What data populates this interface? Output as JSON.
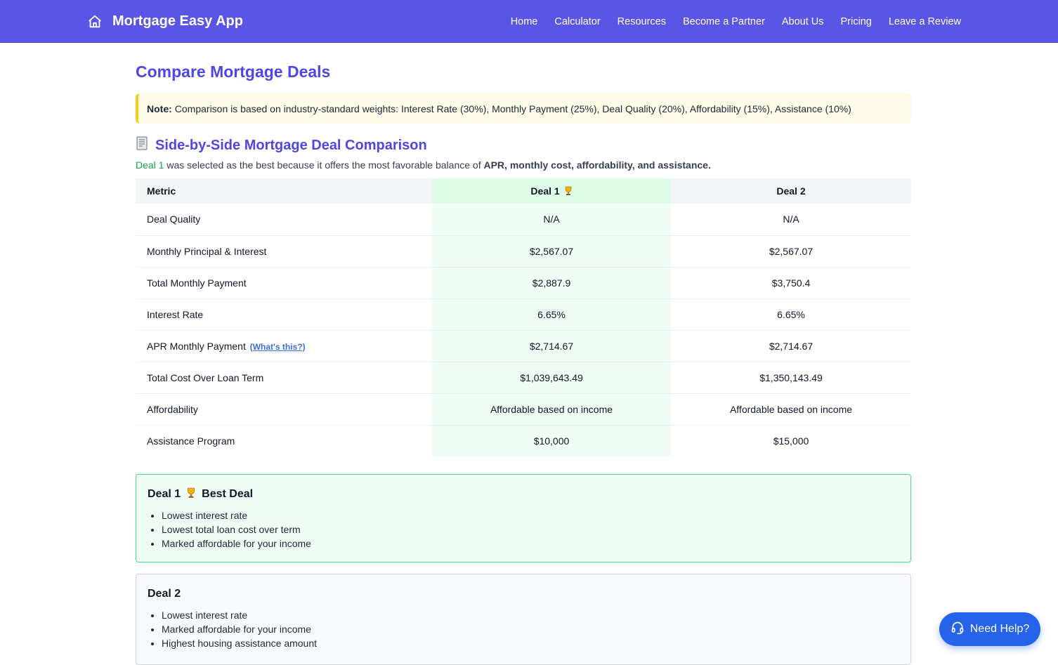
{
  "brand": {
    "name": "Mortgage Easy App",
    "icon": "home-icon"
  },
  "nav": [
    {
      "label": "Home"
    },
    {
      "label": "Calculator"
    },
    {
      "label": "Resources"
    },
    {
      "label": "Become a Partner"
    },
    {
      "label": "About Us"
    },
    {
      "label": "Pricing"
    },
    {
      "label": "Leave a Review"
    }
  ],
  "page": {
    "title": "Compare Mortgage Deals"
  },
  "note": {
    "label": "Note:",
    "text": "Comparison is based on industry-standard weights: Interest Rate (30%), Monthly Payment (25%), Deal Quality (20%), Affordability (15%), Assistance (10%)"
  },
  "comparison": {
    "title": "Side-by-Side Mortgage Deal Comparison",
    "icon": "receipt-icon",
    "summary": {
      "deal": "Deal 1",
      "middle": " was selected as the best because it offers the most favorable balance of ",
      "emphasis": "APR, monthly cost, affordability, and assistance."
    },
    "headers": {
      "metric": "Metric",
      "deal1": "Deal 1",
      "deal2": "Deal 2",
      "winner_icon": "trophy-icon"
    },
    "rows": [
      {
        "metric": "Deal Quality",
        "deal1": "N/A",
        "deal2": "N/A"
      },
      {
        "metric": "Monthly Principal & Interest",
        "deal1": "$2,567.07",
        "deal2": "$2,567.07"
      },
      {
        "metric": "Total Monthly Payment",
        "deal1": "$2,887.9",
        "deal2": "$3,750.4"
      },
      {
        "metric": "Interest Rate",
        "deal1": "6.65%",
        "deal2": "6.65%"
      },
      {
        "metric": "APR Monthly Payment",
        "link": "(What's this?)",
        "deal1": "$2,714.67",
        "deal2": "$2,714.67"
      },
      {
        "metric": "Total Cost Over Loan Term",
        "deal1": "$1,039,643.49",
        "deal2": "$1,350,143.49"
      },
      {
        "metric": "Affordability",
        "deal1": "Affordable based on income",
        "deal2": "Affordable based on income"
      },
      {
        "metric": "Assistance Program",
        "deal1": "$10,000",
        "deal2": "$15,000"
      }
    ]
  },
  "cards": [
    {
      "deal": "Deal 1",
      "badge": "Best Deal",
      "items": [
        "Lowest interest rate",
        "Lowest total loan cost over term",
        "Marked affordable for your income"
      ]
    },
    {
      "deal": "Deal 2",
      "items": [
        "Lowest interest rate",
        "Marked affordable for your income",
        "Highest housing assistance amount"
      ]
    }
  ],
  "help": {
    "label": "Need Help?",
    "icon": "headset-icon"
  },
  "colors": {
    "nav_bg": "#5b55e6",
    "accent": "#4f46e5",
    "win_bg": "#f0fdf4",
    "win_header": "#dcfce7",
    "success": "#16a34a",
    "help_bg": "#2563eb"
  }
}
